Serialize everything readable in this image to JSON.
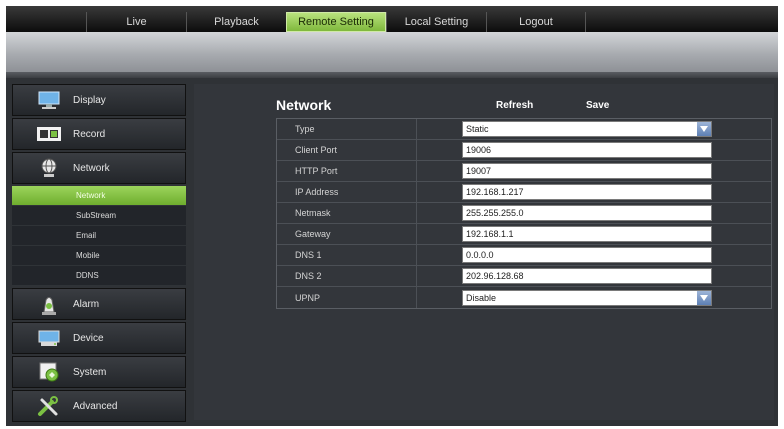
{
  "nav": {
    "tabs": [
      {
        "label": "Live"
      },
      {
        "label": "Playback"
      },
      {
        "label": "Remote Setting"
      },
      {
        "label": "Local Setting"
      },
      {
        "label": "Logout"
      }
    ],
    "active_color": "#8fc84a"
  },
  "sidebar": {
    "items": [
      {
        "label": "Display",
        "icon": "monitor-icon"
      },
      {
        "label": "Record",
        "icon": "film-icon"
      },
      {
        "label": "Network",
        "icon": "globe-icon"
      },
      {
        "label": "Alarm",
        "icon": "siren-icon"
      },
      {
        "label": "Device",
        "icon": "hdd-icon"
      },
      {
        "label": "System",
        "icon": "system-icon"
      },
      {
        "label": "Advanced",
        "icon": "tools-icon"
      }
    ],
    "subitems": [
      {
        "label": "Network"
      },
      {
        "label": "SubStream"
      },
      {
        "label": "Email"
      },
      {
        "label": "Mobile"
      },
      {
        "label": "DDNS"
      }
    ]
  },
  "panel": {
    "title": "Network",
    "refresh_label": "Refresh",
    "save_label": "Save",
    "rows": [
      {
        "label": "Type",
        "value": "Static"
      },
      {
        "label": "Client Port",
        "value": "19006"
      },
      {
        "label": "HTTP Port",
        "value": "19007"
      },
      {
        "label": "IP Address",
        "value": "192.168.1.217"
      },
      {
        "label": "Netmask",
        "value": "255.255.255.0"
      },
      {
        "label": "Gateway",
        "value": "192.168.1.1"
      },
      {
        "label": "DNS 1",
        "value": "0.0.0.0"
      },
      {
        "label": "DNS 2",
        "value": "202.96.128.68"
      },
      {
        "label": "UPNP",
        "value": "Disable"
      }
    ]
  }
}
